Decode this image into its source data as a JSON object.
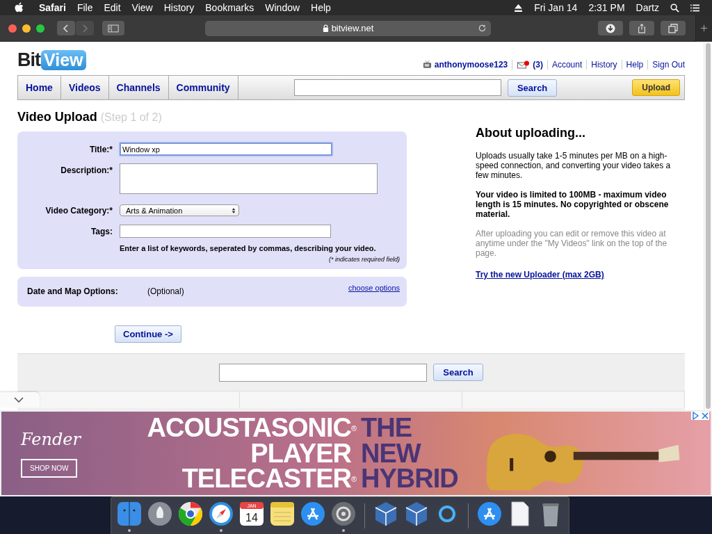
{
  "menu_bar": {
    "menus": [
      {
        "label": "Safari",
        "kind": "app"
      },
      {
        "label": "File",
        "kind": "menu"
      },
      {
        "label": "Edit",
        "kind": "menu"
      },
      {
        "label": "View",
        "kind": "menu"
      },
      {
        "label": "History",
        "kind": "menu"
      },
      {
        "label": "Bookmarks",
        "kind": "menu"
      },
      {
        "label": "Window",
        "kind": "menu"
      },
      {
        "label": "Help",
        "kind": "menu"
      }
    ],
    "clock_date": "Fri Jan 14",
    "clock_time": "2:31 PM",
    "user": "Dartz"
  },
  "browser": {
    "url": "bitview.net"
  },
  "site": {
    "logo_left": "Bit",
    "logo_right": "View",
    "username": "anthonymoose123",
    "message_count": "(3)",
    "account_links": [
      "Account",
      "History",
      "Help",
      "Sign Out"
    ],
    "nav": [
      {
        "label": "Home"
      },
      {
        "label": "Videos"
      },
      {
        "label": "Channels"
      },
      {
        "label": "Community"
      }
    ],
    "search_button": "Search",
    "upload_button": "Upload"
  },
  "upload": {
    "title": "Video Upload",
    "step": "(Step 1 of 2)",
    "fields": [
      {
        "kind": "text",
        "label": "Title:*",
        "value": "Window xp",
        "focused": true
      },
      {
        "kind": "textarea",
        "label": "Description:*",
        "focused": false
      },
      {
        "kind": "select",
        "label": "Video Category:*",
        "value": "Arts & Animation",
        "focused": false
      },
      {
        "kind": "text",
        "label": "Tags:",
        "focused": false
      }
    ],
    "tags_hint": "Enter a list of keywords, seperated by commas, describing your video.",
    "required_note": "(* indicates required field)",
    "options_label": "Date and Map Options:",
    "options_note": "(Optional)",
    "options_link": "choose options",
    "continue_button": "Continue ->"
  },
  "about": {
    "heading": "About uploading...",
    "paragraphs": [
      {
        "kind": "normal",
        "text": "Uploads usually take 1-5 minutes per MB on a high-speed connection, and converting your video takes a few minutes."
      },
      {
        "kind": "bold",
        "text": "Your video is limited to 100MB - maximum video length is 15 minutes. No copyrighted or obscene material."
      },
      {
        "kind": "muted",
        "text": "After uploading you can edit or remove this video at anytime under the \"My Videos\" link on the top of the page."
      }
    ],
    "link": "Try the new Uploader (max 2GB)"
  },
  "footer": {
    "search_button": "Search"
  },
  "ad": {
    "brand": "Fender",
    "cta": "SHOP NOW",
    "lines": [
      {
        "left": "ACOUSTASONIC",
        "mark": "®",
        "right": "THE"
      },
      {
        "left": "PLAYER",
        "right": "NEW"
      },
      {
        "left": "TELECASTER",
        "mark": "®",
        "right": "HYBRID"
      }
    ]
  },
  "dock": {
    "items": [
      {
        "kind": "finder",
        "running": true
      },
      {
        "kind": "launchpad",
        "running": false
      },
      {
        "kind": "chrome",
        "running": false
      },
      {
        "kind": "safari",
        "running": true
      },
      {
        "kind": "calendar",
        "running": false,
        "month": "JAN",
        "day": "14"
      },
      {
        "kind": "notes",
        "running": false
      },
      {
        "kind": "appstore",
        "running": false
      },
      {
        "kind": "settings",
        "running": true
      },
      {
        "kind": "separator"
      },
      {
        "kind": "virtualbox",
        "running": false
      },
      {
        "kind": "virtualbox",
        "running": false
      },
      {
        "kind": "quicktime",
        "running": false
      },
      {
        "kind": "separator"
      },
      {
        "kind": "appstore",
        "running": false
      },
      {
        "kind": "document",
        "running": false
      },
      {
        "kind": "trash",
        "running": false
      }
    ]
  }
}
